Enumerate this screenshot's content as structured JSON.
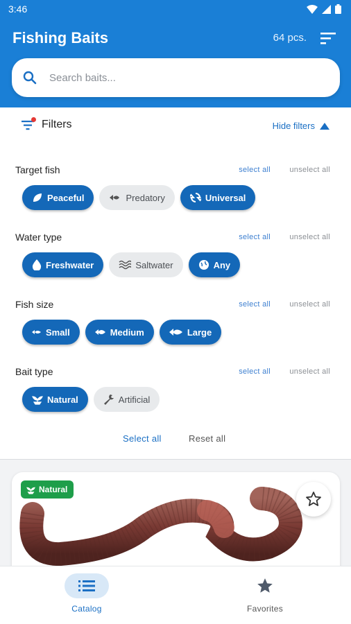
{
  "status": {
    "time": "3:46"
  },
  "header": {
    "title": "Fishing Baits",
    "count": "64 pcs.",
    "sort_icon": "sort-icon"
  },
  "search": {
    "placeholder": "Search baits..."
  },
  "filters": {
    "title": "Filters",
    "hide_label": "Hide filters",
    "groups": [
      {
        "title": "Target fish",
        "select_all": "select all",
        "unselect_all": "unselect all",
        "chips": [
          {
            "label": "Peaceful",
            "selected": true,
            "icon": "leaf-icon"
          },
          {
            "label": "Predatory",
            "selected": false,
            "icon": "fish-hook-icon"
          },
          {
            "label": "Universal",
            "selected": true,
            "icon": "sync-icon"
          }
        ]
      },
      {
        "title": "Water type",
        "select_all": "select all",
        "unselect_all": "unselect all",
        "chips": [
          {
            "label": "Freshwater",
            "selected": true,
            "icon": "water-drop-icon"
          },
          {
            "label": "Saltwater",
            "selected": false,
            "icon": "waves-icon"
          },
          {
            "label": "Any",
            "selected": true,
            "icon": "globe-icon"
          }
        ]
      },
      {
        "title": "Fish size",
        "select_all": "select all",
        "unselect_all": "unselect all",
        "chips": [
          {
            "label": "Small",
            "selected": true,
            "icon": "fish-small-icon"
          },
          {
            "label": "Medium",
            "selected": true,
            "icon": "fish-medium-icon"
          },
          {
            "label": "Large",
            "selected": true,
            "icon": "fish-large-icon"
          }
        ]
      },
      {
        "title": "Bait type",
        "select_all": "select all",
        "unselect_all": "unselect all",
        "chips": [
          {
            "label": "Natural",
            "selected": true,
            "icon": "sprout-icon"
          },
          {
            "label": "Artificial",
            "selected": false,
            "icon": "wrench-icon"
          }
        ]
      }
    ],
    "select_all": "Select all",
    "reset_all": "Reset all"
  },
  "card": {
    "badge": "Natural",
    "badge_color": "#1e9e4a"
  },
  "nav": {
    "catalog": "Catalog",
    "favorites": "Favorites"
  },
  "colors": {
    "primary": "#1a7fd6",
    "chip_selected": "#1468b8",
    "link": "#1a6fc4"
  }
}
